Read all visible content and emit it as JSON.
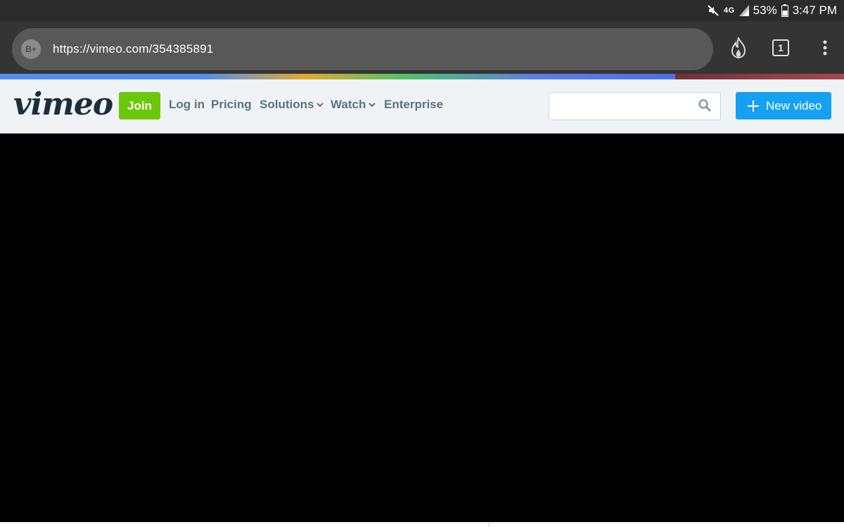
{
  "status_bar": {
    "network": "4G",
    "battery": "53%",
    "time": "3:47 PM"
  },
  "browser": {
    "site_badge": "B+",
    "url": "https://vimeo.com/354385891",
    "tab_count": "1"
  },
  "nav": {
    "logo": "vimeo",
    "join": "Join",
    "login": "Log in",
    "pricing": "Pricing",
    "solutions": "Solutions",
    "watch": "Watch",
    "enterprise": "Enterprise",
    "search_placeholder": "",
    "new_video": "New video"
  },
  "colors": {
    "join": "#6cc70b",
    "new_video": "#16a0f2",
    "logo": "#1a2e3b",
    "nav_text": "#5b7281"
  }
}
